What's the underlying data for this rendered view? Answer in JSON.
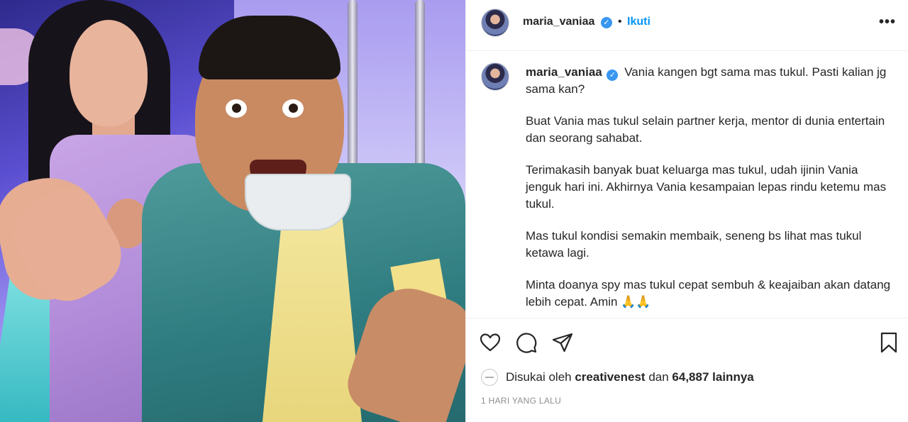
{
  "post": {
    "username": "maria_vaniaa",
    "verified_mark": "✓",
    "separator": "•",
    "follow_label": "Ikuti",
    "more_label": "•••"
  },
  "caption": {
    "username": "maria_vaniaa",
    "paragraphs": [
      "Vania kangen bgt sama mas tukul. Pasti kalian jg sama kan?",
      "Buat Vania mas tukul selain partner kerja, mentor di dunia entertain dan seorang sahabat.",
      "Terimakasih banyak buat keluarga mas tukul, udah ijinin Vania jenguk hari ini. Akhirnya Vania kesampaian lepas rindu ketemu mas tukul.",
      "Mas tukul kondisi semakin membaik, seneng bs lihat mas tukul ketawa lagi.",
      "Minta doanya spy mas tukul cepat sembuh & keajaiban akan datang lebih cepat. Amin 🙏🙏"
    ]
  },
  "actions": {
    "icons": [
      "heart-icon",
      "comment-icon",
      "share-icon",
      "bookmark-icon"
    ]
  },
  "likes": {
    "prefix": "Disukai oleh",
    "liked_by": "creativenest",
    "connector": "dan",
    "count": "64,887",
    "suffix": "lainnya"
  },
  "timestamp": "1 HARI YANG LALU",
  "colors": {
    "link": "#0095f6",
    "verified": "#3897f0",
    "text": "#262626",
    "muted": "#8e8e8e",
    "divider": "#efefef"
  }
}
